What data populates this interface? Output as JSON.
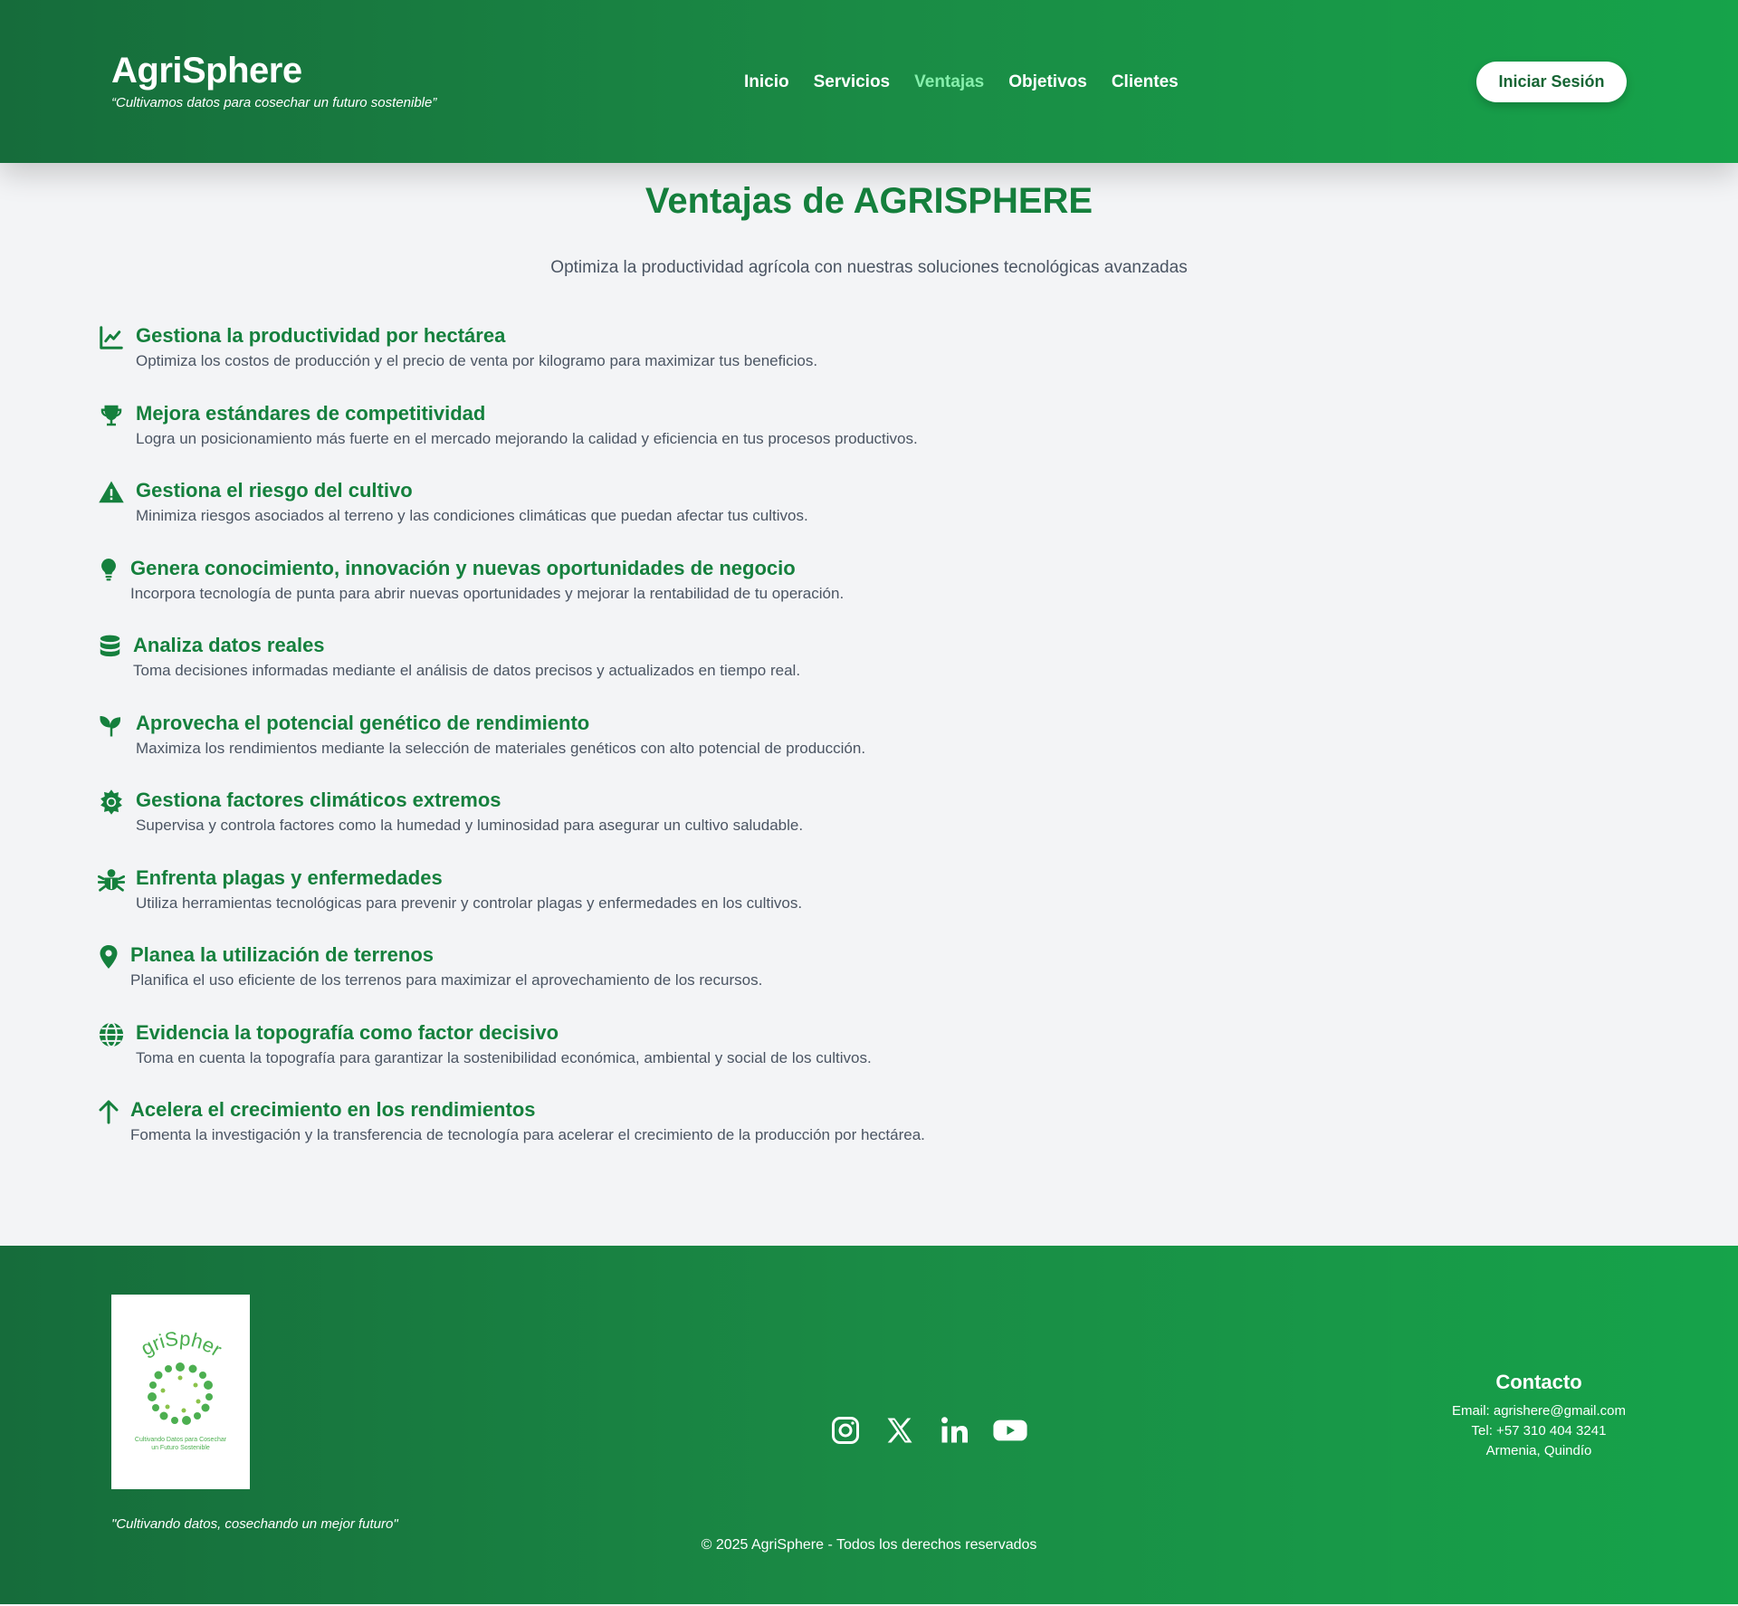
{
  "header": {
    "brand": "AgriSphere",
    "tagline": "“Cultivamos datos para cosechar un futuro sostenible”",
    "nav": [
      "Inicio",
      "Servicios",
      "Ventajas",
      "Objetivos",
      "Clientes"
    ],
    "active_nav": "Ventajas",
    "login_label": "Iniciar Sesión"
  },
  "main": {
    "title": "Ventajas de AGRISPHERE",
    "subtitle": "Optimiza la productividad agrícola con nuestras soluciones tecnológicas avanzadas",
    "features": [
      {
        "icon": "chart-line-icon",
        "title": "Gestiona la productividad por hectárea",
        "desc": "Optimiza los costos de producción y el precio de venta por kilogramo para maximizar tus beneficios."
      },
      {
        "icon": "trophy-icon",
        "title": "Mejora estándares de competitividad",
        "desc": "Logra un posicionamiento más fuerte en el mercado mejorando la calidad y eficiencia en tus procesos productivos."
      },
      {
        "icon": "warning-icon",
        "title": "Gestiona el riesgo del cultivo",
        "desc": "Minimiza riesgos asociados al terreno y las condiciones climáticas que puedan afectar tus cultivos."
      },
      {
        "icon": "lightbulb-icon",
        "title": "Genera conocimiento, innovación y nuevas oportunidades de negocio",
        "desc": "Incorpora tecnología de punta para abrir nuevas oportunidades y mejorar la rentabilidad de tu operación."
      },
      {
        "icon": "database-icon",
        "title": "Analiza datos reales",
        "desc": "Toma decisiones informadas mediante el análisis de datos precisos y actualizados en tiempo real."
      },
      {
        "icon": "seedling-icon",
        "title": "Aprovecha el potencial genético de rendimiento",
        "desc": "Maximiza los rendimientos mediante la selección de materiales genéticos con alto potencial de producción."
      },
      {
        "icon": "sun-icon",
        "title": "Gestiona factores climáticos extremos",
        "desc": "Supervisa y controla factores como la humedad y luminosidad para asegurar un cultivo saludable."
      },
      {
        "icon": "bug-icon",
        "title": "Enfrenta plagas y enfermedades",
        "desc": "Utiliza herramientas tecnológicas para prevenir y controlar plagas y enfermedades en los cultivos."
      },
      {
        "icon": "map-pin-icon",
        "title": "Planea la utilización de terrenos",
        "desc": "Planifica el uso eficiente de los terrenos para maximizar el aprovechamiento de los recursos."
      },
      {
        "icon": "globe-icon",
        "title": "Evidencia la topografía como factor decisivo",
        "desc": "Toma en cuenta la topografía para garantizar la sostenibilidad económica, ambiental y social de los cultivos."
      },
      {
        "icon": "arrow-up-icon",
        "title": "Acelera el crecimiento en los rendimientos",
        "desc": "Fomenta la investigación y la transferencia de tecnología para acelerar el crecimiento de la producción por hectárea."
      }
    ]
  },
  "footer": {
    "logo_text": "AgriSphere",
    "logo_caption_1": "Cultivando Datos para Cosechar",
    "logo_caption_2": "un Futuro Sostenible",
    "quote": "\"Cultivando datos, cosechando un mejor futuro\"",
    "socials": [
      "instagram-icon",
      "x-icon",
      "linkedin-icon",
      "youtube-icon"
    ],
    "copyright": "© 2025 AgriSphere - Todos los derechos reservados",
    "contact": {
      "title": "Contacto",
      "email": "Email: agrishere@gmail.com",
      "phone": "Tel: +57 310 404 3241",
      "city": "Armenia, Quindío"
    }
  },
  "colors": {
    "primary": "#15803d",
    "header_start": "#166c3b",
    "header_end": "#16a34a",
    "nav_active": "#86efac",
    "background": "#f3f4f6"
  }
}
